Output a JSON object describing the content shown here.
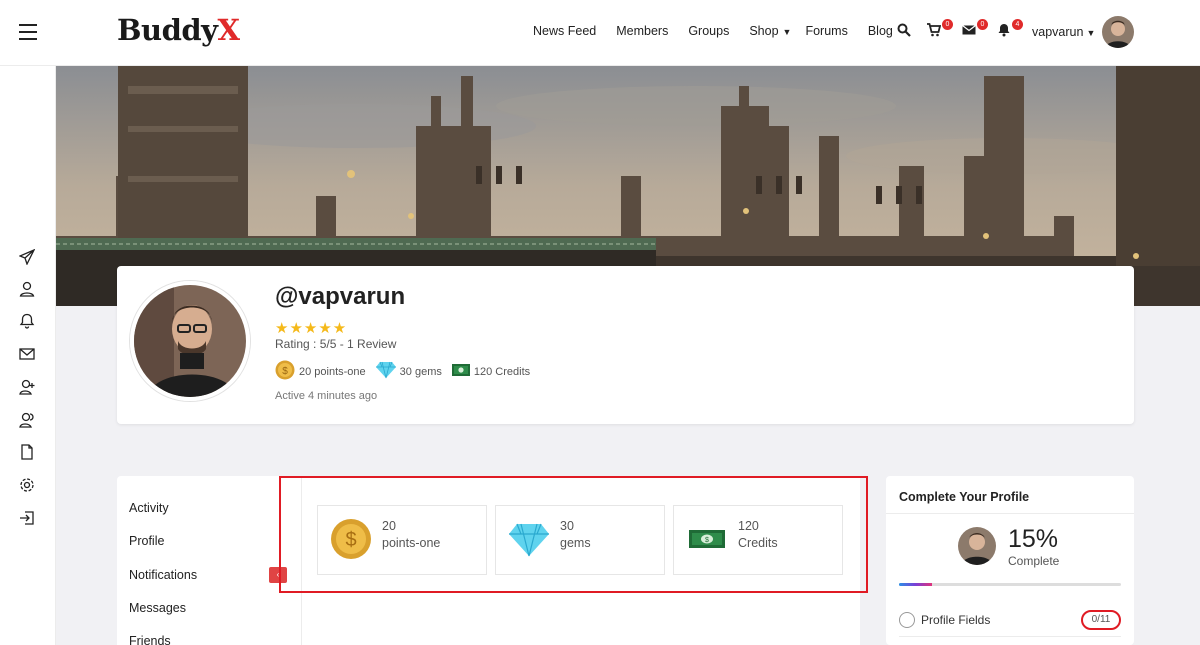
{
  "header": {
    "logo_text": "Buddy",
    "logo_accent": "X",
    "nav": [
      "News Feed",
      "Members",
      "Groups",
      "Shop",
      "Forums",
      "Blog"
    ],
    "cart_count": "0",
    "messages_count": "0",
    "notifications_count": "4",
    "username": "vapvarun"
  },
  "profile": {
    "handle": "@vapvarun",
    "stars": "★★★★★",
    "rating": "Rating : 5/5 - 1 Review",
    "points_label": "20 points-one",
    "gems_label": "30 gems",
    "credits_label": "120 Credits",
    "last_active": "Active 4 minutes ago"
  },
  "subnav": [
    "Activity",
    "Profile",
    "Notifications",
    "Messages",
    "Friends"
  ],
  "collapse_icon": "‹",
  "points_boxes": [
    {
      "value": "20",
      "label": "points-one",
      "icon": "coin-icon"
    },
    {
      "value": "30",
      "label": "gems",
      "icon": "gem-icon"
    },
    {
      "value": "120",
      "label": "Credits",
      "icon": "cash-icon"
    }
  ],
  "widget": {
    "title": "Complete Your Profile",
    "percent": "15%",
    "complete_label": "Complete",
    "progress": 0.15,
    "field_label": "Profile Fields",
    "field_count": "0/11"
  },
  "colors": {
    "brand_red": "#e02a2a",
    "highlight": "#e01b24",
    "star": "#f5b91a"
  }
}
